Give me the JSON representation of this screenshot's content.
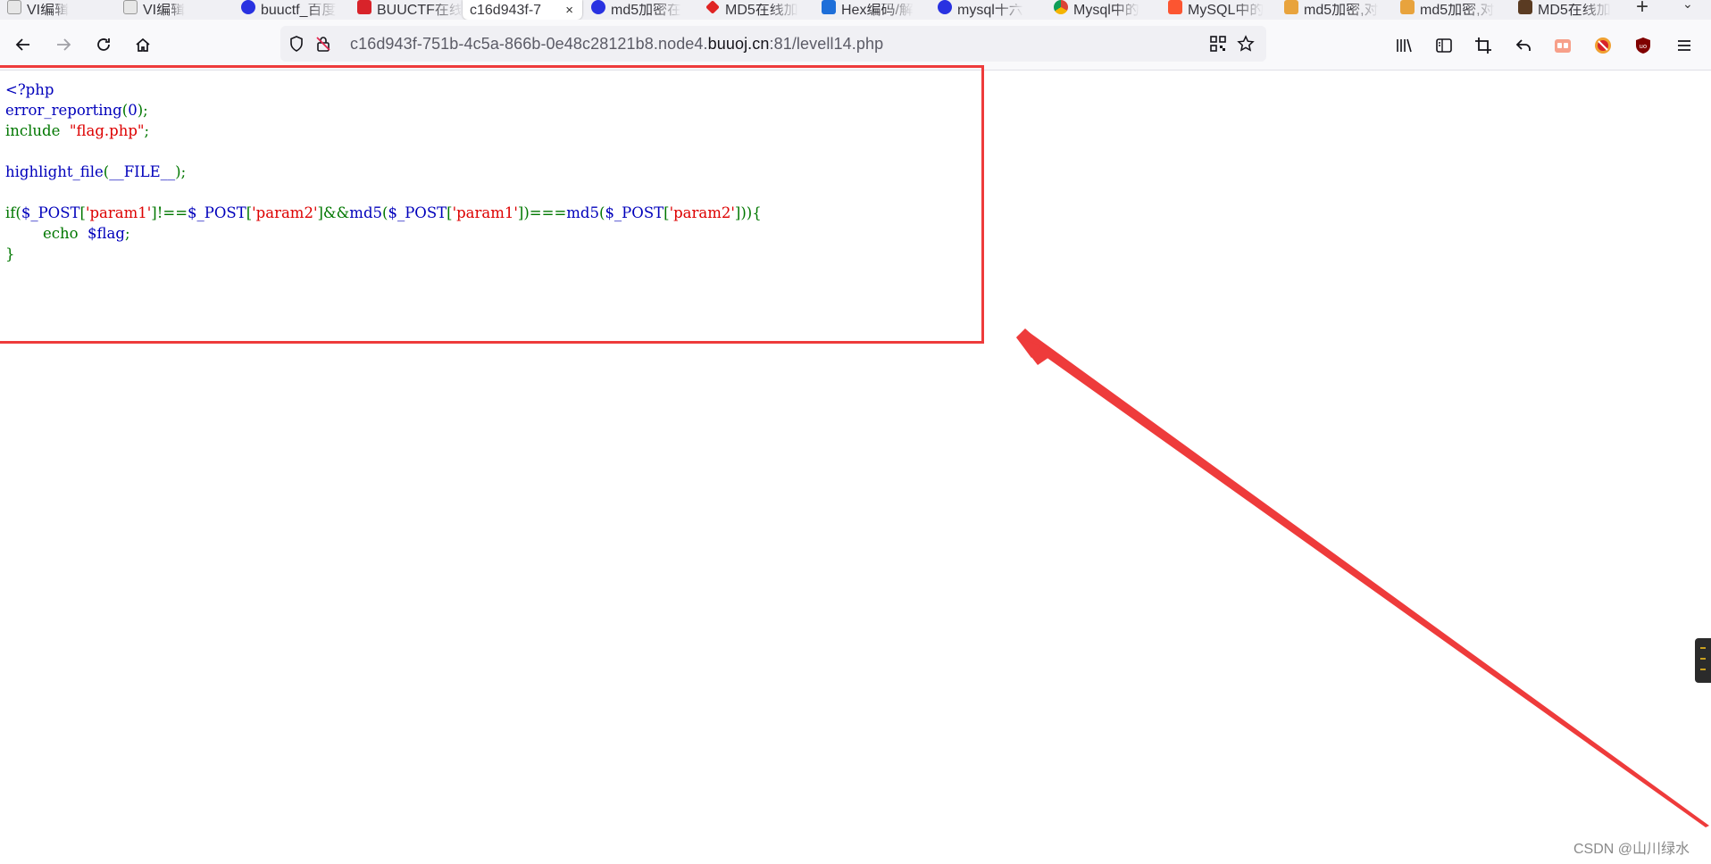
{
  "tabs": [
    {
      "title": "VI编辑",
      "favicon": "vi-logo-icon"
    },
    {
      "title": "VI编辑",
      "favicon": "vi-logo-icon"
    },
    {
      "title": "buuctf_百度",
      "favicon": "baidu-paw-icon"
    },
    {
      "title": "BUUCTF在线",
      "favicon": "buuctf-icon"
    },
    {
      "title": "c16d943f-7",
      "favicon": "none"
    },
    {
      "title": "md5加密在",
      "favicon": "baidu-paw-icon"
    },
    {
      "title": "MD5在线加",
      "favicon": "heart-icon"
    },
    {
      "title": "Hex编码/解",
      "favicon": "hex-icon"
    },
    {
      "title": "mysql十六",
      "favicon": "baidu-paw-icon"
    },
    {
      "title": "Mysql中的",
      "favicon": "chrome-like-icon"
    },
    {
      "title": "MySQL中的",
      "favicon": "csdn-icon"
    },
    {
      "title": "md5加密,对",
      "favicon": "cnblogs-icon"
    },
    {
      "title": "md5加密,对",
      "favicon": "cnblogs-icon"
    },
    {
      "title": "MD5在线加",
      "favicon": "avatar-icon"
    }
  ],
  "active_tab_close": "×",
  "new_tab_label": "+",
  "list_all_tabs": "⌄",
  "url": {
    "prefix": "c16d943f-751b-4c5a-866b-0e48c28121b8.node4.",
    "domain": "buuoj.cn",
    "suffix": ":81/levell14.php"
  },
  "code": {
    "line1": "<?php",
    "line2_fn": "error_reporting",
    "line2_arg": "0",
    "line3_kw": "include",
    "line3_str": "\"flag.php\"",
    "line5_fn": "highlight_file",
    "line5_arg": "__FILE__",
    "line7_if": "if(",
    "line7_var": "$_POST",
    "line7_p1": "'param1'",
    "line7_p2": "'param2'",
    "line7_op1": "!==",
    "line7_op2": "&&",
    "line7_op3": "===",
    "line7_md5": "md5",
    "line8_echo": "echo",
    "line8_var": "$flag",
    "line9": "}"
  },
  "colors": {
    "highlight_box": "#ee3b3b",
    "arrow": "#ee3b3b",
    "php_default": "#0000BB",
    "php_keyword": "#007700",
    "php_string": "#DD0000"
  },
  "watermark": "CSDN @山川绿水"
}
